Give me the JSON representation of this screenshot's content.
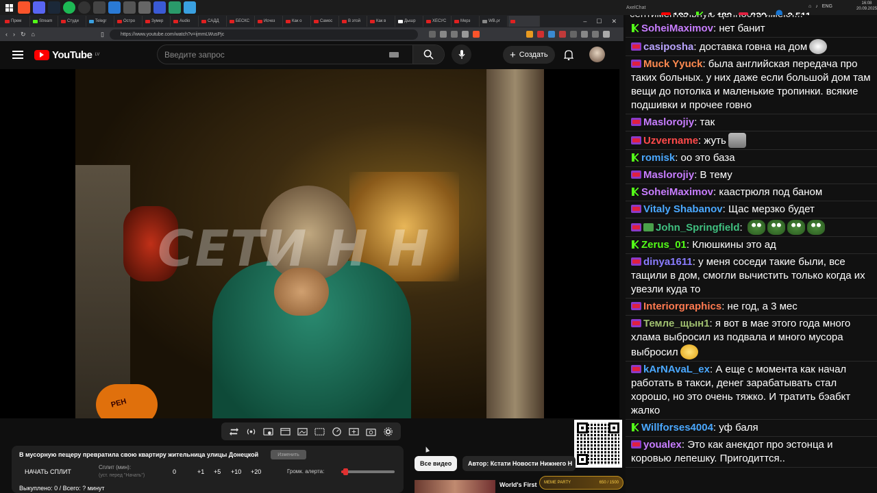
{
  "browser": {
    "tabs": [
      "Прем",
      "Stream",
      "Студи",
      "Telegr",
      "Остро",
      "Зумер",
      "Audio",
      "САДД",
      "БЕСКС",
      "Исчез",
      "Как о",
      "Самос",
      "В этой",
      "Как в",
      "Дышр",
      "ХЕСУС",
      "Мерз",
      "WB.ρr",
      ""
    ],
    "url": "https://www.youtube.com/watch?v=ijmmLWusPjc"
  },
  "youtube": {
    "logo_text": "YouTube",
    "region": "LV",
    "search_placeholder": "Введите запрос",
    "create_label": "Создать"
  },
  "video": {
    "watermark": "СЕТИ Н Н",
    "mic_logo": "РЕН"
  },
  "panel": {
    "title": "В мусорную пещеру превратила свою квартиру жительница улицы Донецкой",
    "apply_button": "Изменить",
    "start_split": "НАЧАТЬ СПЛИТ",
    "split_label": "Сплит (мин):",
    "split_hint": "(уст. перед \"Начать\")",
    "split_value": "0",
    "increments": [
      "+1",
      "+5",
      "+10",
      "+20"
    ],
    "alert_volume_label": "Громк. алерта:",
    "alert_volume_level": 0.08,
    "bought": "Выкуплено: 0 / Всего: ? минут"
  },
  "related": {
    "all_videos": "Все видео",
    "author": "Автор: Кстати Новости Нижнего Н",
    "first_title": "World's First",
    "meme_party": "MEME PARTY",
    "meme_progress": "650 / 1500"
  },
  "overlay": {
    "views_youtube": "183",
    "views_kick": "1,489",
    "views_vk": "839",
    "viewers_total": "2,511",
    "clock_time": "16:08",
    "clock_date": "20.09.2025",
    "lang": "ENG",
    "app": "AxelChat"
  },
  "chat": {
    "cut_text": "сентиментальную ценность имеют...",
    "messages": [
      {
        "badge": "k",
        "nick": "SoheiMaximov",
        "color": "#c77dff",
        "text": "нет банит"
      },
      {
        "badge": "live",
        "nick": "casiposha",
        "color": "#b9a4ff",
        "text": "доставка говна на дом",
        "emote": "joker"
      },
      {
        "badge": "live",
        "nick": "Muck Yyuck",
        "color": "#ff8a50",
        "text": "была английская передача про таких больных. у них даже если большой дом там вещи до потолка и маленькие тропинки. всякие подшивки и прочее говно"
      },
      {
        "badge": "live",
        "nick": "Maslorojiy",
        "color": "#c77dff",
        "text": "так"
      },
      {
        "badge": "live",
        "nick": "Uzvername",
        "color": "#ff4a4a",
        "text": "жуть",
        "emote": "trash"
      },
      {
        "badge": "k",
        "nick": "romisk",
        "color": "#4aa8ff",
        "text": "оо это база"
      },
      {
        "badge": "live",
        "nick": "Maslorojiy",
        "color": "#c77dff",
        "text": "В тему"
      },
      {
        "badge": "k",
        "nick": "SoheiMaximov",
        "color": "#c77dff",
        "text": "каастрюля под баном"
      },
      {
        "badge": "live",
        "nick": "Vitaly Shabanov",
        "color": "#4aa8ff",
        "text": "Щас мерзко будет"
      },
      {
        "badge": "live+check",
        "nick": "John_Springfield",
        "color": "#40c080",
        "text": "",
        "emote": "frog4"
      },
      {
        "badge": "k",
        "nick": "Zerus_01",
        "color": "#53fc18",
        "text": "Клюшкины это ад"
      },
      {
        "badge": "live",
        "nick": "dinya1611",
        "color": "#8a7cff",
        "text": "у меня соседи такие были, все тащили в дом, смогли вычистить только когда их увезли куда то"
      },
      {
        "badge": "live",
        "nick": "Interiorgraphics",
        "color": "#ff7a50",
        "text": "не год, а 3 мес"
      },
      {
        "badge": "live",
        "nick": "Темле_щын1",
        "color": "#a0c070",
        "text": "я вот в мае этого года много хлама выбросил из подвала и много мусора выбросил",
        "emote": "smile"
      },
      {
        "badge": "live",
        "nick": "kArNAvaL_ex",
        "color": "#4aa8ff",
        "text": "А еще с момента как начал работать в такси, денег зарабатывать стал хорошо, но это очень тяжко. И тратить бэабкт жалко"
      },
      {
        "badge": "k",
        "nick": "Willforses4004",
        "color": "#4aa8ff",
        "text": "уф баля"
      },
      {
        "badge": "live",
        "nick": "youalex",
        "color": "#c77dff",
        "text": "Это как анекдот про эстонца и коровью лепешку. Пригодиттся.."
      }
    ]
  }
}
